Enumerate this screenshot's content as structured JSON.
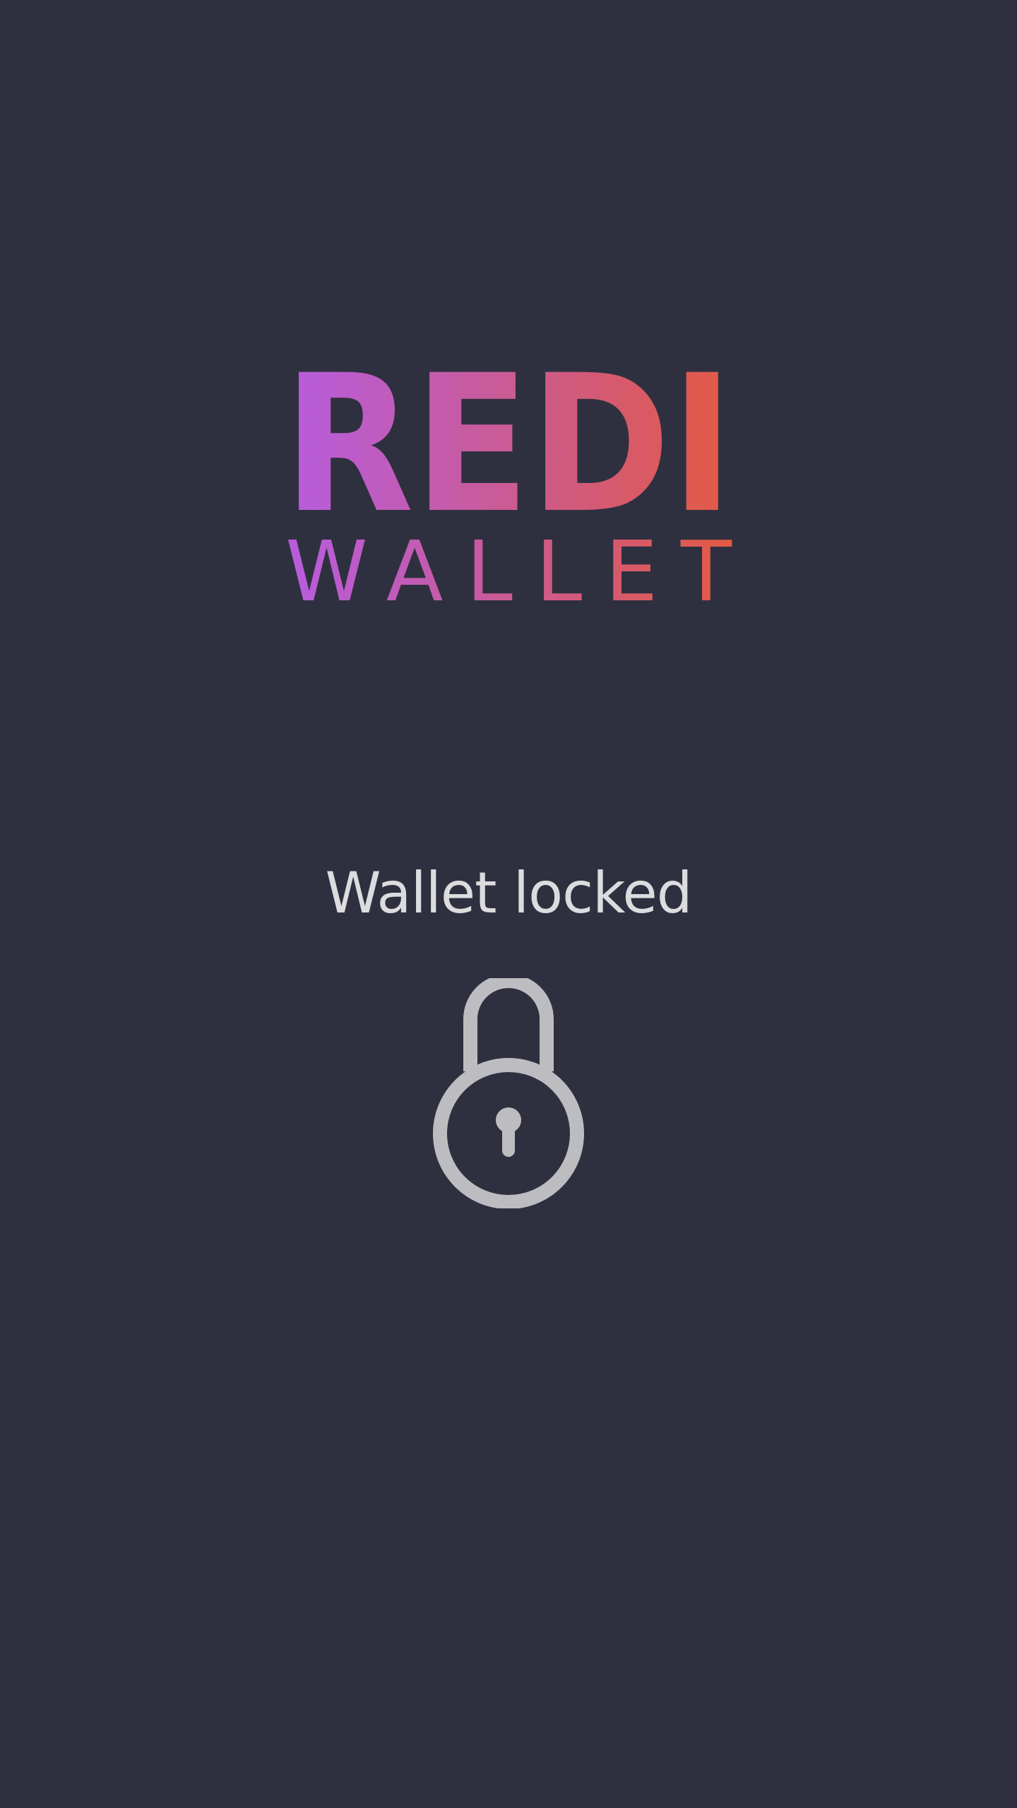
{
  "logo": {
    "word_main": "REDI",
    "word_sub": "WALLET",
    "gradient_start": "#b75ce0",
    "gradient_mid": "#c65a9e",
    "gradient_end": "#e35a42"
  },
  "status": {
    "text": "Wallet locked"
  },
  "lock_icon": {
    "name": "padlock-icon",
    "color": "#bdbdc1"
  },
  "background_color": "#2f303f"
}
